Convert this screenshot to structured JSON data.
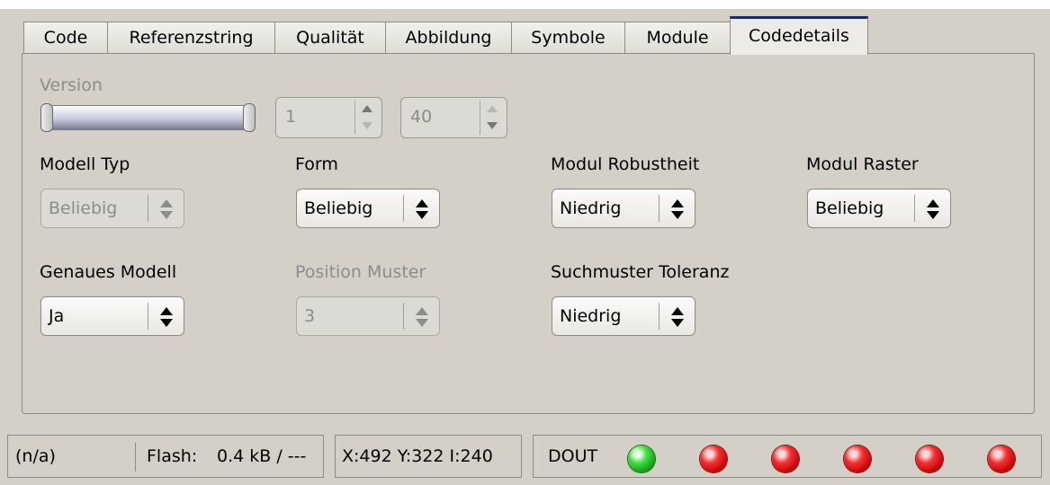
{
  "tabs": [
    {
      "label": "Code",
      "active": false
    },
    {
      "label": "Referenzstring",
      "active": false
    },
    {
      "label": "Qualität",
      "active": false
    },
    {
      "label": "Abbildung",
      "active": false
    },
    {
      "label": "Symbole",
      "active": false
    },
    {
      "label": "Module",
      "active": false
    },
    {
      "label": "Codedetails",
      "active": true
    }
  ],
  "version": {
    "label": "Version",
    "min_value": "1",
    "max_value": "40"
  },
  "fields": {
    "modell_typ": {
      "label": "Modell Typ",
      "value": "Beliebig",
      "enabled": false
    },
    "form": {
      "label": "Form",
      "value": "Beliebig",
      "enabled": true
    },
    "modul_robustheit": {
      "label": "Modul Robustheit",
      "value": "Niedrig",
      "enabled": true
    },
    "modul_raster": {
      "label": "Modul Raster",
      "value": "Beliebig",
      "enabled": true
    },
    "genaues_modell": {
      "label": "Genaues Modell",
      "value": "Ja",
      "enabled": true
    },
    "position_muster": {
      "label": "Position Muster",
      "value": "3",
      "enabled": false
    },
    "suchmuster_toleranz": {
      "label": "Suchmuster Toleranz",
      "value": "Niedrig",
      "enabled": true
    }
  },
  "statusbar": {
    "state": "(n/a)",
    "flash_label": "Flash:",
    "flash_value": "0.4 kB / ---",
    "coords": "X:492 Y:322 I:240",
    "dout_label": "DOUT",
    "leds": [
      "green",
      "red",
      "red",
      "red",
      "red",
      "red"
    ]
  },
  "colors": {
    "background": "#d4d0c8",
    "active_tab_accent": "#1b2b6a",
    "led_on": "#18c018",
    "led_off": "#e00000"
  },
  "icons": [
    "spin-up-icon",
    "spin-down-icon",
    "combo-arrows-icon",
    "led-icon"
  ]
}
